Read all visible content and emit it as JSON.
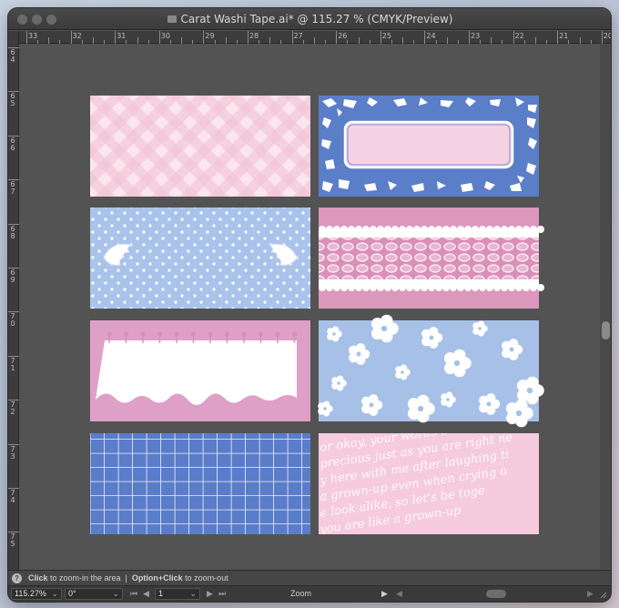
{
  "window": {
    "title": "Carat Washi Tape.ai* @ 115.27 % (CMYK/Preview)"
  },
  "ruler_top": [
    "33",
    "32",
    "31",
    "30",
    "29",
    "28",
    "27",
    "26",
    "25",
    "24",
    "23",
    "22",
    "21",
    "20"
  ],
  "ruler_left": [
    "64",
    "65",
    "66",
    "67",
    "68",
    "69",
    "70",
    "71",
    "72",
    "73",
    "74",
    "75"
  ],
  "canvas": {
    "tiles": [
      {
        "name": "pink-gingham-tape",
        "pattern": "pink gingham"
      },
      {
        "name": "blue-camo-label-tape",
        "pattern": "blue camo with pink label"
      },
      {
        "name": "blue-dots-wings-tape",
        "pattern": "blue polka dots with angel wings"
      },
      {
        "name": "pink-lace-tape",
        "pattern": "pink with white lace"
      },
      {
        "name": "pink-notepaper-tape",
        "pattern": "pink with torn notepaper"
      },
      {
        "name": "blue-floral-tape",
        "pattern": "blue with white flowers"
      },
      {
        "name": "blue-grid-tape",
        "pattern": "blue grid"
      },
      {
        "name": "pink-script-tape",
        "pattern": "pink cursive script"
      }
    ],
    "script_lines": [
      "or okay, your words a re right w",
      "precious just as you are right ne",
      "y here with me after laughing ti",
      "a grown-up even when crying o",
      "e look alike, so let's be toge",
      "you are like a grown-up"
    ]
  },
  "statusbar": {
    "help_icon": "?",
    "click_label": "Click",
    "click_text": " to zoom-in the area  |  ",
    "option_label": "Option+Click",
    "option_text": " to zoom-out"
  },
  "bottombar": {
    "zoom_value": "115.27%",
    "rotation_value": "0°",
    "artboard_value": "1",
    "tool_label": "Zoom"
  },
  "colors": {
    "pink": "#f5cfe0",
    "blue": "#5b7ec9",
    "light_blue": "#a7c1ea",
    "mauve": "#d89fc2"
  }
}
